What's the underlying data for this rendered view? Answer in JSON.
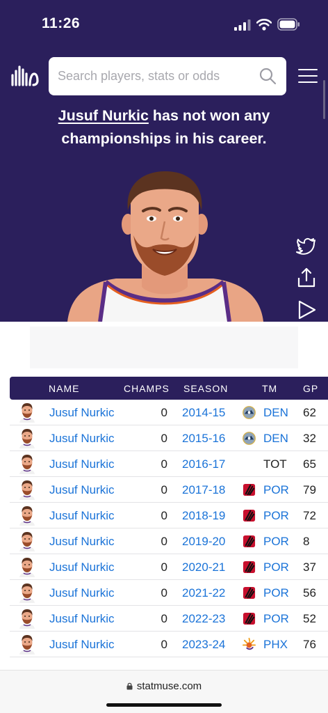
{
  "status_bar": {
    "time": "11:26"
  },
  "search": {
    "placeholder": "Search players, stats or odds"
  },
  "headline": {
    "player": "Jusuf Nurkic",
    "text": " has not won any championships in his career."
  },
  "table": {
    "columns": [
      "NAME",
      "CHAMPS",
      "SEASON",
      "TM",
      "GP"
    ],
    "rows": [
      {
        "name": "Jusuf Nurkic",
        "champs": "0",
        "season": "2014-15",
        "team": "DEN",
        "team_logo": "nuggets-logo-icon",
        "gp": "62"
      },
      {
        "name": "Jusuf Nurkic",
        "champs": "0",
        "season": "2015-16",
        "team": "DEN",
        "team_logo": "nuggets-logo-icon",
        "gp": "32"
      },
      {
        "name": "Jusuf Nurkic",
        "champs": "0",
        "season": "2016-17",
        "team": "TOT",
        "team_logo": "",
        "gp": "65"
      },
      {
        "name": "Jusuf Nurkic",
        "champs": "0",
        "season": "2017-18",
        "team": "POR",
        "team_logo": "blazers-logo-icon",
        "gp": "79"
      },
      {
        "name": "Jusuf Nurkic",
        "champs": "0",
        "season": "2018-19",
        "team": "POR",
        "team_logo": "blazers-logo-icon",
        "gp": "72"
      },
      {
        "name": "Jusuf Nurkic",
        "champs": "0",
        "season": "2019-20",
        "team": "POR",
        "team_logo": "blazers-logo-icon",
        "gp": "8"
      },
      {
        "name": "Jusuf Nurkic",
        "champs": "0",
        "season": "2020-21",
        "team": "POR",
        "team_logo": "blazers-logo-icon",
        "gp": "37"
      },
      {
        "name": "Jusuf Nurkic",
        "champs": "0",
        "season": "2021-22",
        "team": "POR",
        "team_logo": "blazers-logo-icon",
        "gp": "56"
      },
      {
        "name": "Jusuf Nurkic",
        "champs": "0",
        "season": "2022-23",
        "team": "POR",
        "team_logo": "blazers-logo-icon",
        "gp": "52"
      },
      {
        "name": "Jusuf Nurkic",
        "champs": "0",
        "season": "2023-24",
        "team": "PHX",
        "team_logo": "suns-logo-icon",
        "gp": "76"
      }
    ]
  },
  "browser": {
    "url": "statmuse.com"
  },
  "colors": {
    "brand_purple": "#2b1f5c",
    "link_blue": "#1a73d8"
  }
}
